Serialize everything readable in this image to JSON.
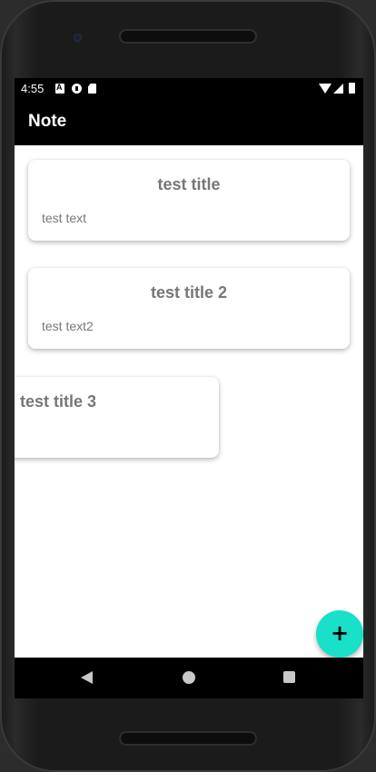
{
  "status_bar": {
    "time": "4:55",
    "icons": [
      "a-notification-icon",
      "p-notification-icon",
      "sd-card-icon",
      "wifi-icon",
      "signal-icon",
      "battery-icon"
    ]
  },
  "app_bar": {
    "title": "Note"
  },
  "notes": [
    {
      "title": "test title",
      "text": "test text"
    },
    {
      "title": "test title 2",
      "text": "test text2"
    },
    {
      "title": "test title 3",
      "text": ""
    }
  ],
  "fab": {
    "label": "+",
    "color": "#19e0c8"
  },
  "nav_bar": {
    "icons": [
      "back-icon",
      "home-icon",
      "recent-apps-icon"
    ]
  },
  "colors": {
    "app_bar": "#000000",
    "card_text": "#777777",
    "accent": "#19e0c8"
  }
}
